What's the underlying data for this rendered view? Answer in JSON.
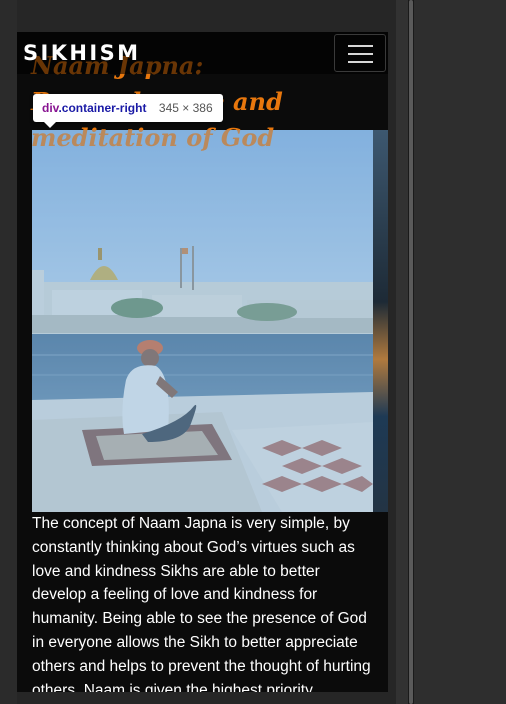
{
  "navbar": {
    "brand": "SIKHISM",
    "menu_icon": "hamburger-menu-icon"
  },
  "page": {
    "title": "Naam Japna: Remembrance and meditation of God",
    "paragraph": "The concept of Naam Japna is very simple, by constantly thinking about God’s virtues such as love and kindness Sikhs are able to better develop a feeling of love and kindness for humanity. Being able to see the presence of God in everyone allows the Sikh to better appreciate others and helps to prevent the thought of hurting others. Naam is given the highest priority"
  },
  "devtools_tooltip": {
    "tag": "div",
    "class_name": ".container-right",
    "size": "345 × 386"
  },
  "image": {
    "subject": "golden-temple-meditation-photo"
  },
  "colors": {
    "title_accent": "#e8770d",
    "highlight_overlay": "#6fa8dc",
    "page_background": "#0b0b0b",
    "tooltip_tag": "#881391"
  }
}
